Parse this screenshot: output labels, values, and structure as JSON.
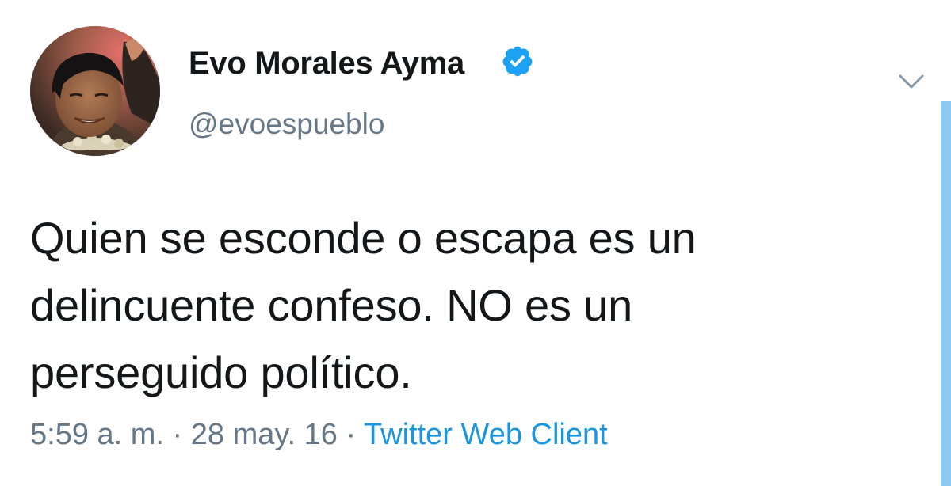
{
  "user": {
    "display_name": "Evo Morales Ayma",
    "handle": "@evoespueblo",
    "verified": true
  },
  "tweet": {
    "lines": [
      "Quien se esconde o escapa es un",
      "delincuente confeso. NO es un",
      "perseguido político."
    ]
  },
  "meta": {
    "time": "5:59 a. m.",
    "separator": "·",
    "date": "28 may. 16",
    "source": "Twitter Web Client"
  },
  "icons": {
    "verified": "verified-badge-icon",
    "caret": "chevron-down-icon"
  },
  "colors": {
    "text": "#14171a",
    "muted": "#657786",
    "link": "#1b95e0",
    "verified": "#1da1f2",
    "scrollbar": "#8cc8ef"
  }
}
